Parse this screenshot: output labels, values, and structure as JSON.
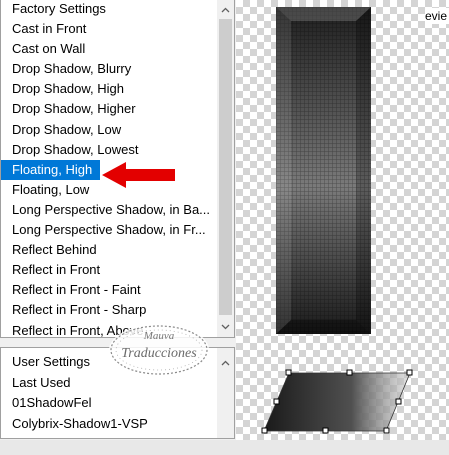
{
  "presets_list": {
    "items": [
      "Factory Settings",
      "Cast in Front",
      "Cast on Wall",
      "Drop Shadow, Blurry",
      "Drop Shadow, High",
      "Drop Shadow, Higher",
      "Drop Shadow, Low",
      "Drop Shadow, Lowest",
      "Floating, High",
      "Floating, Low",
      "Long Perspective Shadow, in Ba...",
      "Long Perspective Shadow, in Fr...",
      "Reflect Behind",
      "Reflect in Front",
      "Reflect in Front - Faint",
      "Reflect in Front - Sharp",
      "Reflect in Front, Above"
    ],
    "selected": "Floating, High"
  },
  "user_list": {
    "items": [
      "User Settings",
      "Last Used",
      "01ShadowFel",
      "Colybrix-Shadow1-VSP"
    ]
  },
  "preview": {
    "label": "evie"
  },
  "watermark": {
    "line1": "Mauva",
    "line2": "Traducciones"
  },
  "colors": {
    "selection": "#0078d7",
    "arrow": "#e30000"
  }
}
